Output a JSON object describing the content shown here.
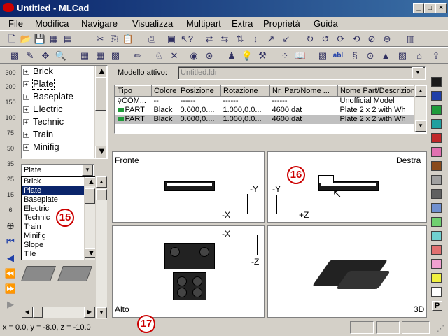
{
  "window": {
    "title": "Untitled - MLCad"
  },
  "menu": [
    "File",
    "Modifica",
    "Navigare",
    "Visualizza",
    "Multipart",
    "Extra",
    "Proprietà",
    "Guida"
  ],
  "tree": {
    "items": [
      "Brick",
      "Plate",
      "Baseplate",
      "Electric",
      "Technic",
      "Train",
      "Minifig"
    ],
    "selected": "Plate"
  },
  "left_rail": [
    "300",
    "200",
    "150",
    "100",
    "75",
    "50",
    "35",
    "25",
    "15",
    "6"
  ],
  "parts_filter": {
    "value": "Plate",
    "options": [
      "Brick",
      "Plate",
      "Baseplate",
      "Electric",
      "Technic",
      "Train",
      "Minifig",
      "Slope",
      "Tile"
    ],
    "selected": "Plate"
  },
  "model": {
    "label": "Modello attivo:",
    "value": "Untitled.ldr"
  },
  "table": {
    "headers": [
      "Tipo",
      "Colore",
      "Posizione",
      "Rotazione",
      "Nr. Part/Nome ...",
      "Nome Part/Descrizion"
    ],
    "rows": [
      [
        "COM...",
        "--",
        "------",
        "------",
        "------",
        "Unofficial Model"
      ],
      [
        "PART",
        "Black",
        "0.000,0....",
        "1.000,0.0...",
        "4600.dat",
        "Plate  2 x  2 with Wh"
      ],
      [
        "PART",
        "Black",
        "0.000,0....",
        "1.000,0.0...",
        "4600.dat",
        "Plate  2 x  2 with Wh"
      ]
    ]
  },
  "views": {
    "front": {
      "label": "Fronte",
      "axis_v": "-Y",
      "axis_h": "-X"
    },
    "right": {
      "label": "Destra",
      "axis_v": "-Y",
      "axis_h": "+Z"
    },
    "top": {
      "label": "Alto",
      "axis_v": "-Z",
      "axis_h": "-X"
    },
    "three_d": {
      "label": "3D"
    }
  },
  "badges": {
    "b15": "15",
    "b16": "16",
    "b17": "17"
  },
  "status": {
    "coords": "x = 0.0, y = -8.0, z = -10.0"
  },
  "palette": [
    "#1a1a1a",
    "#1f3fa8",
    "#1f9a3a",
    "#1fa0a0",
    "#c0282a",
    "#e070b0",
    "#8a4a1a",
    "#a0a0a0",
    "#606060",
    "#7090d0",
    "#70d070",
    "#70d0d0",
    "#e07070",
    "#f0a0d0",
    "#f0f040",
    "#ffffff"
  ],
  "palette_p": "P",
  "colors": {
    "title_start": "#0a246a",
    "title_end": "#3a6ea5",
    "selection": "#0a246a",
    "badge": "#cc0000"
  }
}
